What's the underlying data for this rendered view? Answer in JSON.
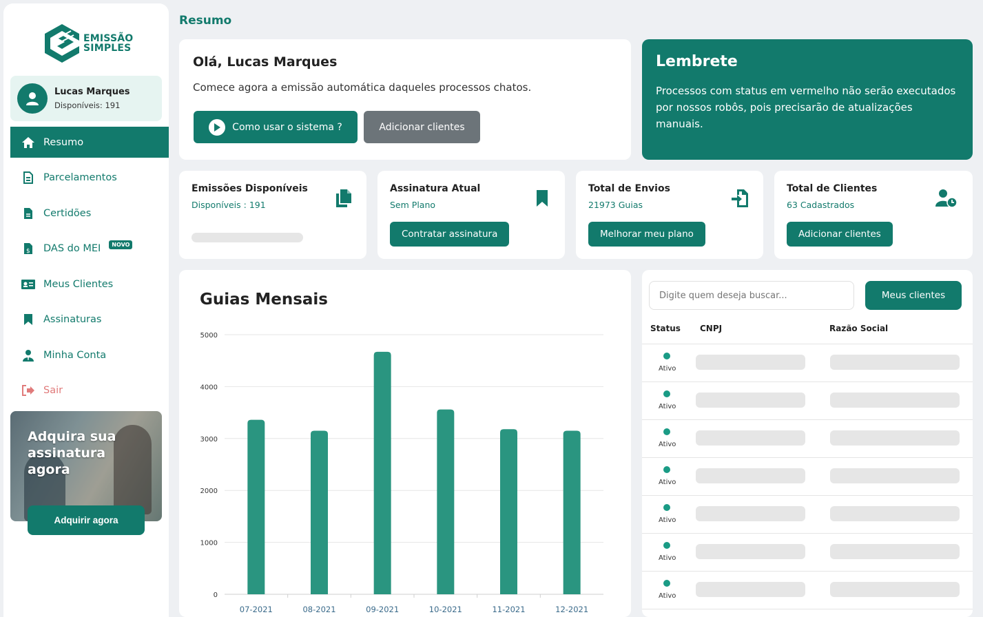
{
  "brand": {
    "line1": "EMISSÃO",
    "line2": "SIMPLES",
    "color": "#127a6c"
  },
  "user": {
    "name": "Lucas Marques",
    "available": "Disponíveis: 191"
  },
  "nav": [
    {
      "label": "Resumo",
      "icon": "home-icon",
      "active": true
    },
    {
      "label": "Parcelamentos",
      "icon": "document-list-icon"
    },
    {
      "label": "Certidões",
      "icon": "document-icon"
    },
    {
      "label": "DAS do MEI",
      "icon": "dollar-document-icon",
      "badge": "NOVO"
    },
    {
      "label": "Meus Clientes",
      "icon": "id-card-icon"
    },
    {
      "label": "Assinaturas",
      "icon": "bookmark-icon"
    },
    {
      "label": "Minha Conta",
      "icon": "user-tie-icon"
    },
    {
      "label": "Sair",
      "icon": "logout-icon"
    }
  ],
  "promo": {
    "title_lines": [
      "Adquira sua",
      "assinatura",
      "agora"
    ],
    "button": "Adquirir agora"
  },
  "page_title": "Resumo",
  "welcome": {
    "title": "Olá, Lucas Marques",
    "text": "Comece agora a emissão automática daqueles processos chatos.",
    "primary_button": "Como usar o sistema ?",
    "secondary_button": "Adicionar clientes"
  },
  "reminder": {
    "title": "Lembrete",
    "text": "Processos com status em vermelho não serão executados por nossos robôs, pois precisarão de atualizações manuais."
  },
  "stats": [
    {
      "title": "Emissões Disponíveis",
      "sub": "Disponíveis : 191",
      "icon": "copy-documents-icon"
    },
    {
      "title": "Assinatura Atual",
      "sub": "Sem Plano",
      "icon": "bookmark-icon",
      "button": "Contratar assinatura"
    },
    {
      "title": "Total de Envios",
      "sub": "21973 Guias",
      "icon": "file-import-icon",
      "button": "Melhorar meu plano"
    },
    {
      "title": "Total de Clientes",
      "sub": "63 Cadastrados",
      "icon": "user-clock-icon",
      "button": "Adicionar clientes"
    }
  ],
  "chart_title": "Guias Mensais",
  "chart_data": {
    "type": "bar",
    "title": "Guias Mensais",
    "categories": [
      "07-2021",
      "08-2021",
      "09-2021",
      "10-2021",
      "11-2021",
      "12-2021"
    ],
    "values": [
      3360,
      3150,
      4670,
      3560,
      3180,
      3150
    ],
    "yticks": [
      0,
      1000,
      2000,
      3000,
      4000,
      5000
    ],
    "ylim": [
      0,
      5000
    ],
    "grid": true,
    "color": "#2a9580"
  },
  "table": {
    "search_placeholder": "Digite quem deseja buscar...",
    "button": "Meus clientes",
    "columns": [
      "Status",
      "CNPJ",
      "Razão Social"
    ],
    "rows": [
      {
        "status": "Ativo"
      },
      {
        "status": "Ativo"
      },
      {
        "status": "Ativo"
      },
      {
        "status": "Ativo"
      },
      {
        "status": "Ativo"
      },
      {
        "status": "Ativo"
      },
      {
        "status": "Ativo"
      }
    ]
  }
}
